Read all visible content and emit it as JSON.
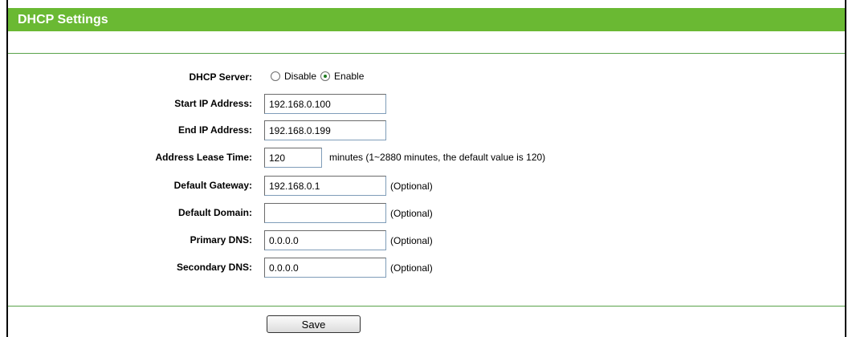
{
  "header": {
    "title": "DHCP Settings"
  },
  "dhcp_server": {
    "label": "DHCP Server:",
    "options": [
      {
        "label": "Disable",
        "checked": false
      },
      {
        "label": "Enable",
        "checked": true
      }
    ]
  },
  "start_ip": {
    "label": "Start IP Address:",
    "value": "192.168.0.100"
  },
  "end_ip": {
    "label": "End IP Address:",
    "value": "192.168.0.199"
  },
  "lease_time": {
    "label": "Address Lease Time:",
    "value": "120",
    "note": "minutes (1~2880 minutes, the default value is 120)"
  },
  "default_gateway": {
    "label": "Default Gateway:",
    "value": "192.168.0.1",
    "note": "(Optional)"
  },
  "default_domain": {
    "label": "Default Domain:",
    "value": "",
    "note": "(Optional)"
  },
  "primary_dns": {
    "label": "Primary DNS:",
    "value": "0.0.0.0",
    "note": "(Optional)"
  },
  "secondary_dns": {
    "label": "Secondary DNS:",
    "value": "0.0.0.0",
    "note": "(Optional)"
  },
  "save_label": "Save"
}
